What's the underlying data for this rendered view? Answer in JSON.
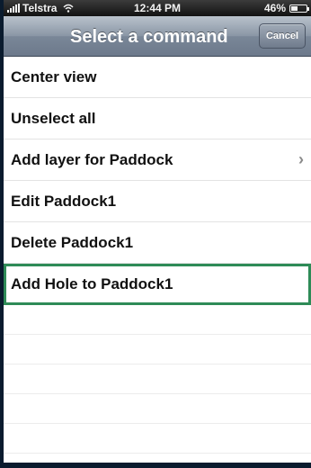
{
  "status_bar": {
    "carrier": "Telstra",
    "time": "12:44 PM",
    "battery": "46%",
    "battery_level": 0.46
  },
  "nav_bar": {
    "title": "Select a command",
    "cancel_label": "Cancel"
  },
  "commands": [
    {
      "label": "Center view"
    },
    {
      "label": "Unselect all"
    },
    {
      "label": "Add layer for Paddock",
      "chevron": "›"
    },
    {
      "label": "Edit Paddock1"
    },
    {
      "label": "Delete Paddock1"
    },
    {
      "label": "Add Hole to Paddock1"
    }
  ],
  "colors": {
    "selected_border": "#2e8b57",
    "nav_bar": "#7a8798"
  }
}
